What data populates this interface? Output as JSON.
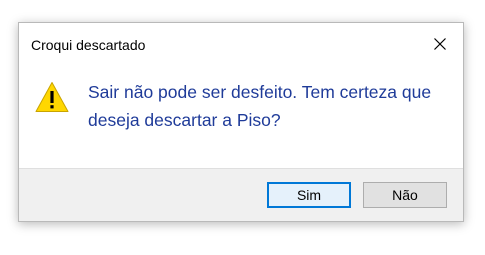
{
  "dialog": {
    "title": "Croqui descartado",
    "close_icon": "close-icon",
    "icon": "warning-icon",
    "message": "Sair não pode ser desfeito. Tem certeza que deseja descartar a Piso?",
    "buttons": {
      "yes_label": "Sim",
      "no_label": "Não"
    },
    "colors": {
      "message_text": "#1f3b99",
      "warning_fill": "#ffd700",
      "default_button_border": "#0078d7",
      "footer_background": "#f0f0f0"
    }
  }
}
